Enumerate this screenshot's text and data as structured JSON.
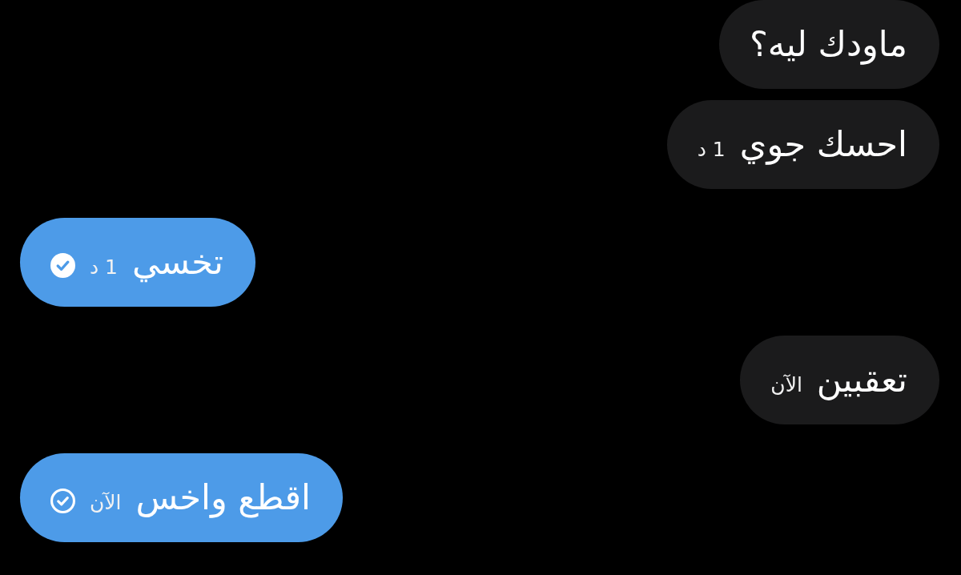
{
  "messages": [
    {
      "kind": "incoming",
      "text": "ماودك ليه؟"
    },
    {
      "kind": "incoming",
      "text": "احسك جوي",
      "time": "1 د"
    },
    {
      "kind": "outgoing",
      "text": "تخسي",
      "time": "1 د",
      "read": true
    },
    {
      "kind": "incoming",
      "text": "تعقبين",
      "time": "الآن"
    },
    {
      "kind": "outgoing",
      "text": "اقطع واخس",
      "time": "الآن",
      "read": false
    }
  ]
}
